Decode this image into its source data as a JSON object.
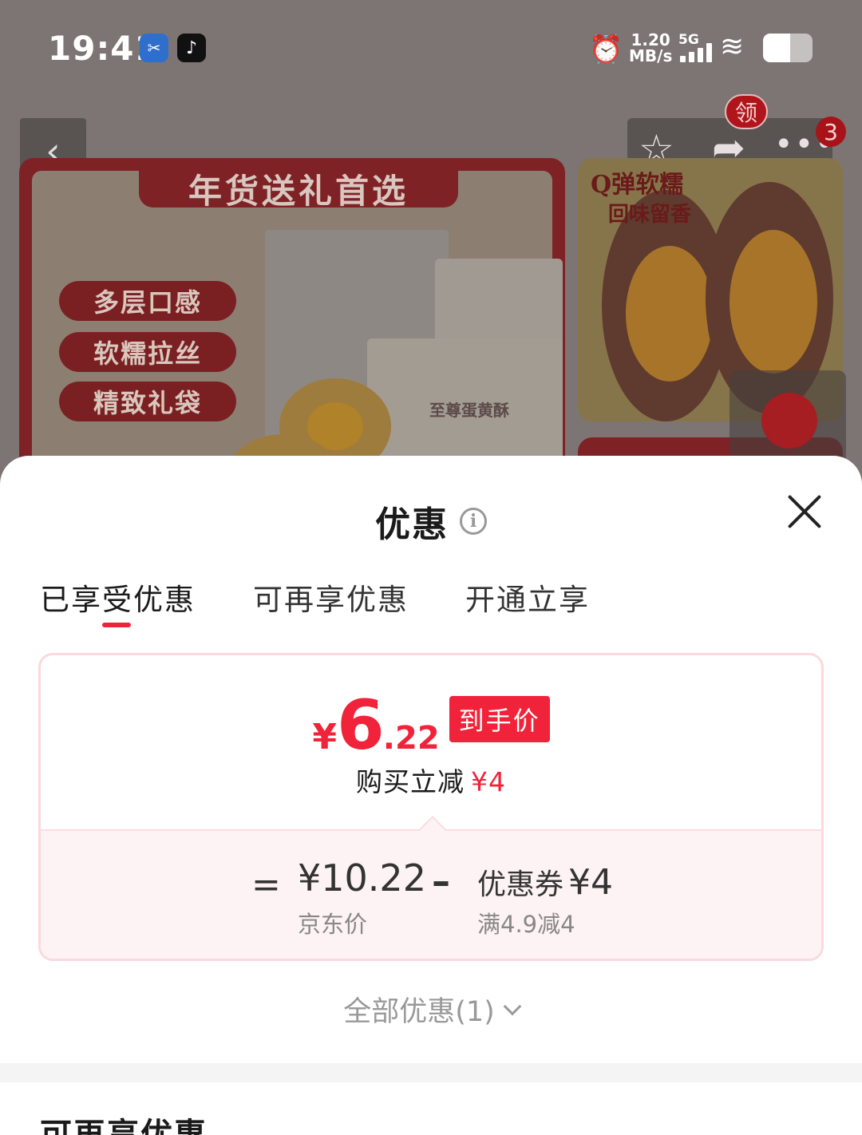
{
  "status_bar": {
    "time": "19:41",
    "net_speed_value": "1.20",
    "net_speed_unit": "MB/s",
    "network_type": "5G",
    "icons": [
      "screencast-app-icon",
      "tiktok-app-icon",
      "alarm-icon",
      "signal-icon",
      "wifi-icon",
      "battery-icon"
    ]
  },
  "product_page": {
    "nav_badge_label": "领",
    "cart_count": "3",
    "banner_title": "年货送礼首选",
    "banner_features": [
      "多层口感",
      "软糯拉丝",
      "精致礼袋"
    ],
    "box_label": "至尊蛋黄酥",
    "side_caption_1": "Q弹软糯",
    "side_caption_2": "回味留香"
  },
  "sheet": {
    "title": "优惠",
    "tabs": [
      {
        "label": "已享受优惠",
        "active": true
      },
      {
        "label": "可再享优惠",
        "active": false
      },
      {
        "label": "开通立享",
        "active": false
      }
    ],
    "price": {
      "currency": "¥",
      "integer": "6",
      "decimal": ".22",
      "tag": "到手价"
    },
    "savings_label": "购买立减",
    "savings_amount": "¥4",
    "calc": {
      "equals": "=",
      "jd_price": "¥10.22",
      "jd_price_label": "京东价",
      "minus": "–",
      "coupon_label": "优惠券",
      "coupon_amount": "¥4",
      "coupon_condition": "满4.9减4"
    },
    "all_offers_label": "全部优惠(1)",
    "next_section_title": "可再享优惠"
  },
  "colors": {
    "accent_red": "#f0233a",
    "card_border": "#fbd9df",
    "calc_bg": "#fdf2f4"
  }
}
